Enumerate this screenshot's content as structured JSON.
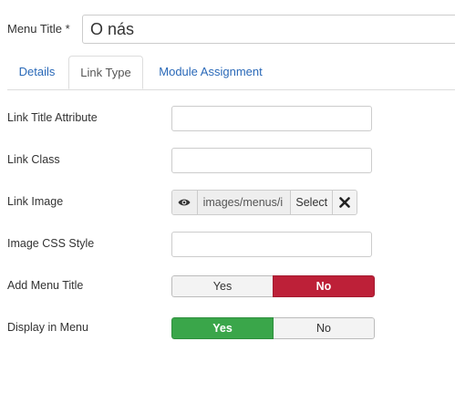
{
  "menu_title": {
    "label": "Menu Title *",
    "value": "O nás"
  },
  "tabs": [
    {
      "label": "Details",
      "active": false
    },
    {
      "label": "Link Type",
      "active": true
    },
    {
      "label": "Module Assignment",
      "active": false
    }
  ],
  "fields": {
    "link_title_attribute": {
      "label": "Link Title Attribute",
      "value": ""
    },
    "link_class": {
      "label": "Link Class",
      "value": ""
    },
    "link_image": {
      "label": "Link Image",
      "path": "images/menus/i",
      "select_label": "Select",
      "preview_icon": "eye-icon",
      "clear_icon": "close-icon"
    },
    "image_css_style": {
      "label": "Image CSS Style",
      "value": ""
    },
    "add_menu_title": {
      "label": "Add Menu Title",
      "yes_label": "Yes",
      "no_label": "No",
      "selected": "No"
    },
    "display_in_menu": {
      "label": "Display in Menu",
      "yes_label": "Yes",
      "no_label": "No",
      "selected": "Yes"
    }
  },
  "colors": {
    "tab_link": "#2a69b8",
    "no_active": "#bd2038",
    "yes_active": "#3aa64a"
  }
}
